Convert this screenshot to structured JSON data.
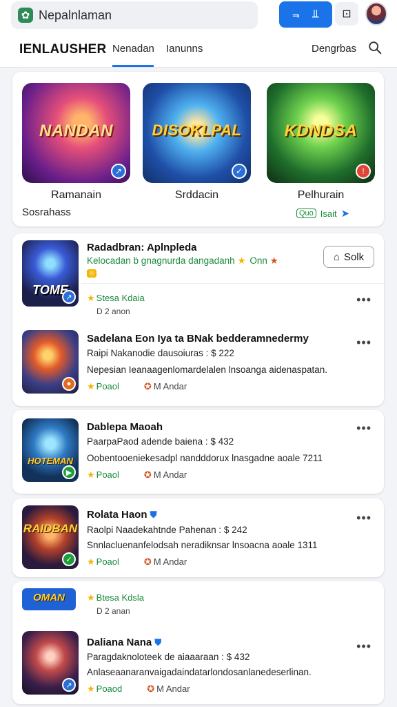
{
  "topbar": {
    "search_text": "Nepalnlaman",
    "action_left": "⫬",
    "action_right": "⫫",
    "camera_glyph": "⊡"
  },
  "tabs": {
    "brand": "IENLAUSHER",
    "active": "Nenadan",
    "second": "Ianunns",
    "right": "Dengrbas"
  },
  "featured": {
    "tiles": [
      {
        "art": "NANDAN",
        "label": "Ramanain"
      },
      {
        "art": "DISOKLPAL",
        "label": "Srddacin"
      },
      {
        "art": "KDNDSA",
        "label": "Pelhurain"
      }
    ],
    "footer": "Sosrahass",
    "link_chip": "Quo",
    "link_text": "Isait"
  },
  "items": [
    {
      "title": "Radadbran: Aplnpleda",
      "line1": "Kelocadan ḃ gnagnurda dangadanh",
      "line1_tail": "Onn",
      "solk": "Solk",
      "meta_g": "Stesa Kdaia",
      "sub": "D 2 anon",
      "art": "TOME"
    },
    {
      "title": "Sadelana Eon Iya ta BNak bedderamnedermy",
      "line1": "Raipi Nakanodie dausoiuras : $ 222",
      "line2": "Nepesian Ieanaagenlomardelalen lnsoanga aidenaspatan.",
      "meta_g": "Poaol",
      "meta_r": "M Andar",
      "art": ""
    },
    {
      "title": "Dablepa Maoah",
      "line1": "PaarpaPaod adende baiena : $ 432",
      "line2": "Oobentooeniekesadpl nandddorux lnasgadne aoale 7211",
      "meta_g": "Poaol",
      "meta_r": "M Andar",
      "art": "HOTEMAN"
    },
    {
      "title": "Rolata Haon",
      "line1": "Raolpi Naadekahtnde Pahenan : $ 242",
      "line2": "Snnlacluenanfelodsah neradiknsar lnsoacna aoale 1311",
      "meta_g": "Poaol",
      "meta_r": "M Andar",
      "art": "RAIDBAN"
    },
    {
      "meta_g": "Btesa Kdsla",
      "sub": "D 2 anan",
      "art": "OMAN"
    },
    {
      "title": "Daliana Nana",
      "line1": "Paragdaknoloteek de aiaaaraan : $ 432",
      "line2": "Anlaseaanaranvaigadaindatarlondosanlanedeserlinan.",
      "meta_g": "Poaod",
      "meta_r": "M Andar",
      "art": ""
    }
  ]
}
